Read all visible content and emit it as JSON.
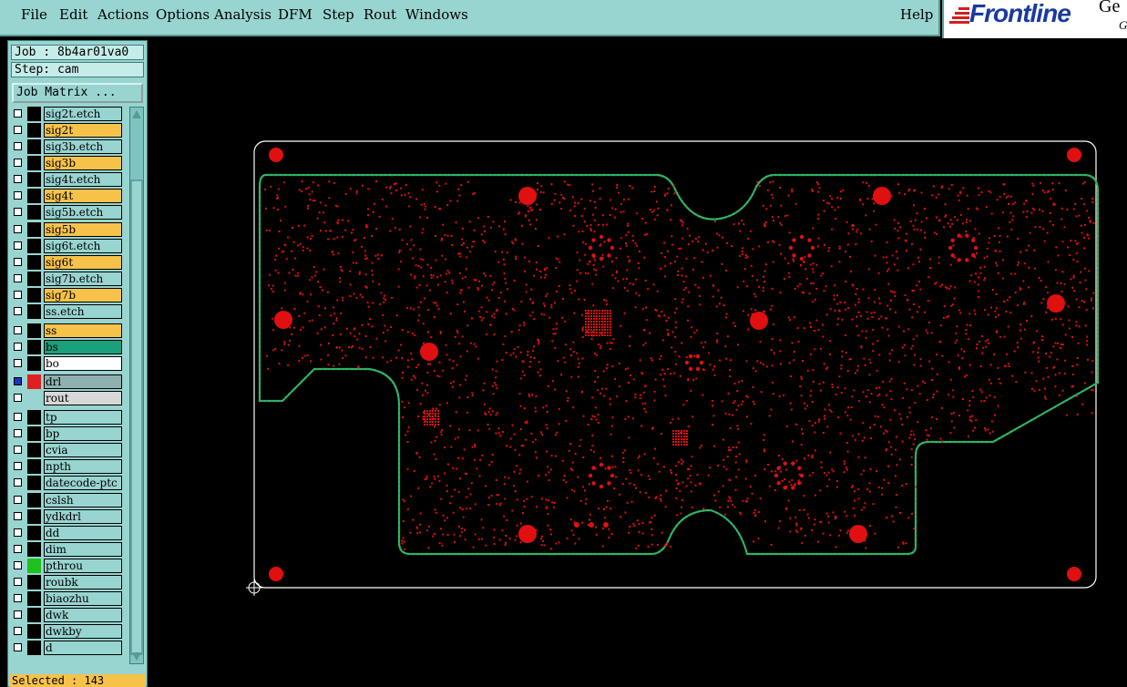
{
  "menu": {
    "items": [
      {
        "label": "File"
      },
      {
        "label": "Edit"
      },
      {
        "label": "Actions"
      },
      {
        "label": "Options"
      },
      {
        "label": "Analysis"
      },
      {
        "label": "DFM"
      },
      {
        "label": "Step"
      },
      {
        "label": "Rout"
      },
      {
        "label": "Windows"
      }
    ],
    "help": "Help"
  },
  "logo": {
    "text": "Frontline",
    "extra": "Ge",
    "extra2": "G"
  },
  "panel": {
    "job": "Job : 8b4ar01va0",
    "step": "Step: cam",
    "job_matrix": "Job Matrix ..."
  },
  "layers": [
    {
      "name": "sig2t.etch",
      "bg": "#98d4d0"
    },
    {
      "name": "sig2t",
      "bg": "#f6c24a"
    },
    {
      "name": "sig3b.etch",
      "bg": "#98d4d0"
    },
    {
      "name": "sig3b",
      "bg": "#f6c24a"
    },
    {
      "name": "sig4t.etch",
      "bg": "#98d4d0"
    },
    {
      "name": "sig4t",
      "bg": "#f6c24a"
    },
    {
      "name": "sig5b.etch",
      "bg": "#98d4d0"
    },
    {
      "name": "sig5b",
      "bg": "#f6c24a"
    },
    {
      "name": "sig6t.etch",
      "bg": "#98d4d0"
    },
    {
      "name": "sig6t",
      "bg": "#f6c24a"
    },
    {
      "name": "sig7b.etch",
      "bg": "#98d4d0"
    },
    {
      "name": "sig7b",
      "bg": "#f6c24a"
    },
    {
      "name": "ss.etch",
      "bg": "#98d4d0"
    },
    {
      "name": "ss",
      "bg": "#f6c24a"
    },
    {
      "name": "bs",
      "bg": "#1aa07a"
    },
    {
      "name": "bo",
      "bg": "#ffffff"
    },
    {
      "name": "drl",
      "bg": "#8fb0b0"
    },
    {
      "name": "rout",
      "bg": "#d8d8d8"
    },
    {
      "name": "tp",
      "bg": "#98d4d0"
    },
    {
      "name": "bp",
      "bg": "#98d4d0"
    },
    {
      "name": "cvia",
      "bg": "#98d4d0"
    },
    {
      "name": "npth",
      "bg": "#98d4d0"
    },
    {
      "name": "datecode-ptc",
      "bg": "#98d4d0"
    },
    {
      "name": "cslsh",
      "bg": "#98d4d0"
    },
    {
      "name": "ydkdrl",
      "bg": "#98d4d0"
    },
    {
      "name": "dd",
      "bg": "#98d4d0"
    },
    {
      "name": "dim",
      "bg": "#98d4d0"
    },
    {
      "name": "pthrou",
      "bg": "#98d4d0"
    },
    {
      "name": "roubk",
      "bg": "#98d4d0"
    },
    {
      "name": "biaozhu",
      "bg": "#98d4d0"
    },
    {
      "name": "dwk",
      "bg": "#98d4d0"
    },
    {
      "name": "dwkby",
      "bg": "#98d4d0"
    },
    {
      "name": "d",
      "bg": "#98d4d0"
    }
  ],
  "status": {
    "selected": "Selected : 143"
  },
  "colors": {
    "pad": "#e01010",
    "outline": "#2fb04a",
    "board_edge": "#ffffff",
    "dashed": "#3fb0d8"
  }
}
